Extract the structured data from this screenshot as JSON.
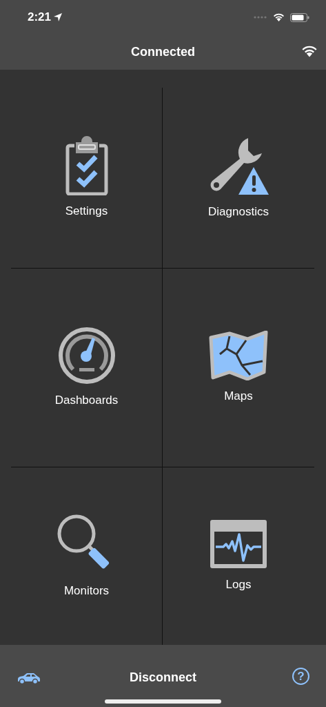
{
  "status_bar": {
    "time": "2:21"
  },
  "nav_bar": {
    "title": "Connected"
  },
  "tiles": [
    {
      "label": "Settings",
      "kind": "settings"
    },
    {
      "label": "Diagnostics",
      "kind": "diagnostics"
    },
    {
      "label": "Dashboards",
      "kind": "dashboards"
    },
    {
      "label": "Maps",
      "kind": "maps"
    },
    {
      "label": "Monitors",
      "kind": "monitors"
    },
    {
      "label": "Logs",
      "kind": "logs"
    }
  ],
  "bottom_bar": {
    "action": "Disconnect",
    "help": "?"
  }
}
